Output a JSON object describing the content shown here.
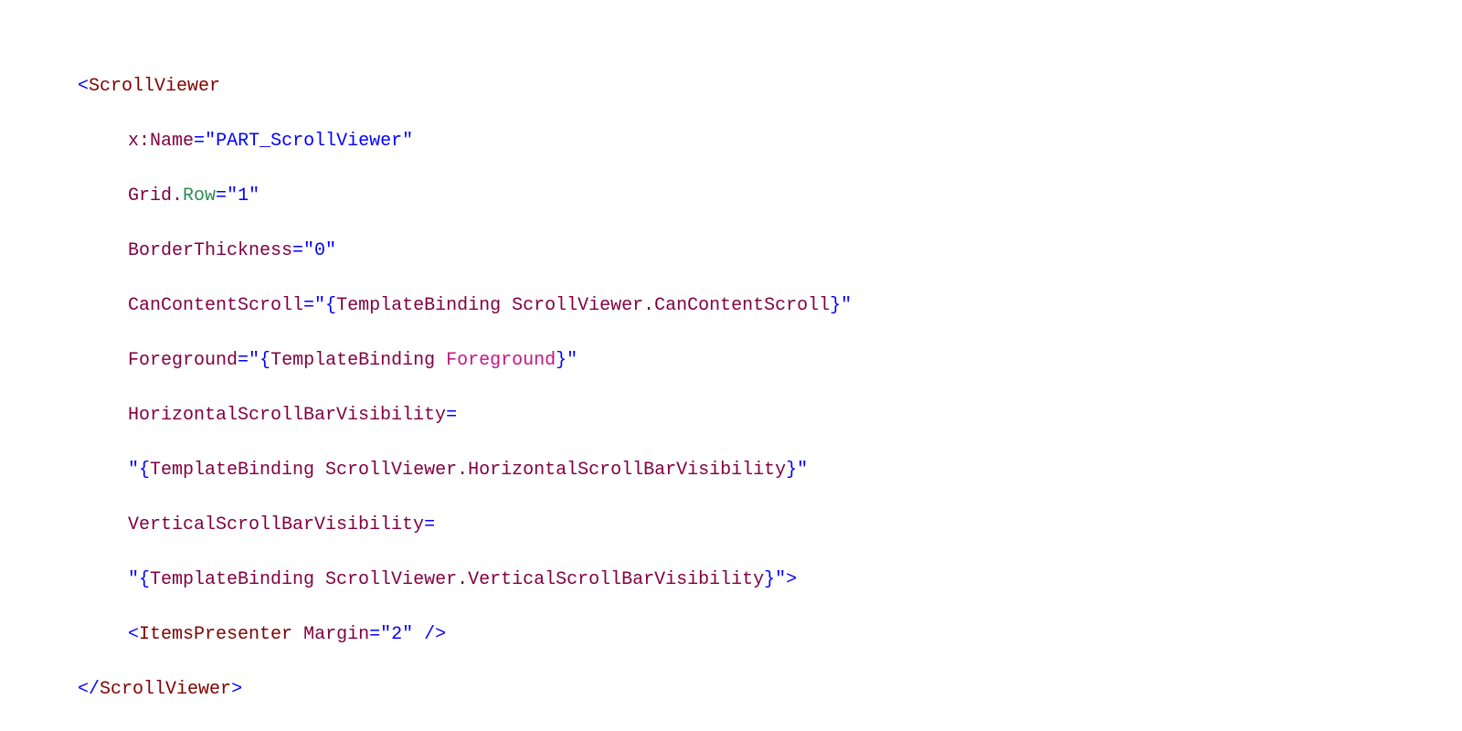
{
  "tags": {
    "open_bracket": "<",
    "close_bracket": ">",
    "close_slash": "/",
    "self_close": " />",
    "scrollViewer": "ScrollViewer",
    "itemsPresenter": "ItemsPresenter"
  },
  "attrs": {
    "x": "x",
    "colon": ":",
    "name": "Name",
    "grid": "Grid",
    "dot": ".",
    "row": "Row",
    "borderThickness": "BorderThickness",
    "canContentScroll": "CanContentScroll",
    "foreground": "Foreground",
    "horizontalScrollBarVisibility": "HorizontalScrollBarVisibility",
    "verticalScrollBarVisibility": "VerticalScrollBarVisibility",
    "margin": "Margin"
  },
  "values": {
    "partScrollViewer": "\"PART_ScrollViewer\"",
    "one": "\"1\"",
    "zero": "\"0\"",
    "two": "\"2\"",
    "quoteOpen": "\"{",
    "quoteClose": "}\"",
    "templateBinding": "TemplateBinding ",
    "svCanContentScroll": "ScrollViewer.CanContentScroll",
    "svHorizontal": "ScrollViewer.HorizontalScrollBarVisibility",
    "svVertical": "ScrollViewer.VerticalScrollBarVisibility",
    "foregroundKw": "Foreground"
  },
  "eq": "="
}
